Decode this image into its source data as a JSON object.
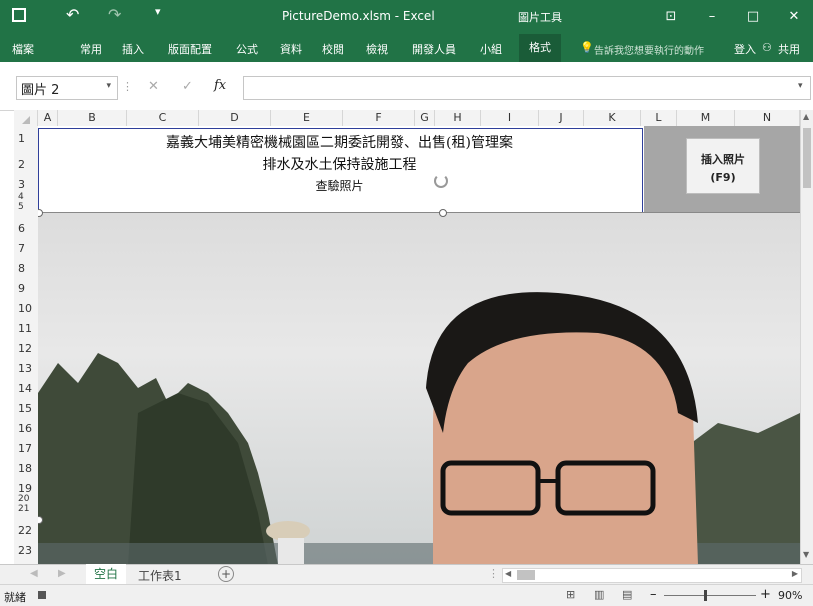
{
  "window": {
    "title": "PictureDemo.xlsm - Excel",
    "context_tab": "圖片工具",
    "controls": {
      "ribbon_opts": "⊡",
      "minimize": "–",
      "maximize": "□",
      "close": "✕"
    }
  },
  "ribbon": {
    "tabs": [
      "檔案",
      "常用",
      "插入",
      "版面配置",
      "公式",
      "資料",
      "校閱",
      "檢視",
      "開發人員",
      "小組",
      "格式"
    ],
    "active_tab": "格式",
    "tellme": "告訴我您想要執行的動作",
    "signin": "登入",
    "share": "共用"
  },
  "formula_bar": {
    "name_box": "圖片 2",
    "cancel": "✕",
    "enter": "✓",
    "fx": "fx",
    "formula": ""
  },
  "columns": [
    "A",
    "B",
    "C",
    "D",
    "E",
    "F",
    "G",
    "H",
    "I",
    "J",
    "K",
    "L",
    "M",
    "N"
  ],
  "rows": [
    "1",
    "2",
    "3",
    "4",
    "5",
    "6",
    "7",
    "8",
    "9",
    "10",
    "11",
    "12",
    "13",
    "14",
    "15",
    "16",
    "17",
    "18",
    "19",
    "20",
    "21",
    "22",
    "23"
  ],
  "sheet": {
    "title_line1": "嘉義大埔美精密機械園區二期委託開發、出售(租)管理案",
    "title_line2": "排水及水土保持設施工程",
    "title_line3": "查驗照片",
    "button_line1": "插入照片",
    "button_line2": "(F9)"
  },
  "sheet_tabs": {
    "tabs": [
      "空白",
      "工作表1"
    ],
    "active": "空白",
    "add": "+"
  },
  "status": {
    "ready": "就緒",
    "zoom": "90%",
    "zoom_minus": "–",
    "zoom_plus": "+"
  },
  "colors": {
    "excel_green": "#217346",
    "title_border": "#2f3f9a",
    "button_area": "#a6a6a6"
  }
}
